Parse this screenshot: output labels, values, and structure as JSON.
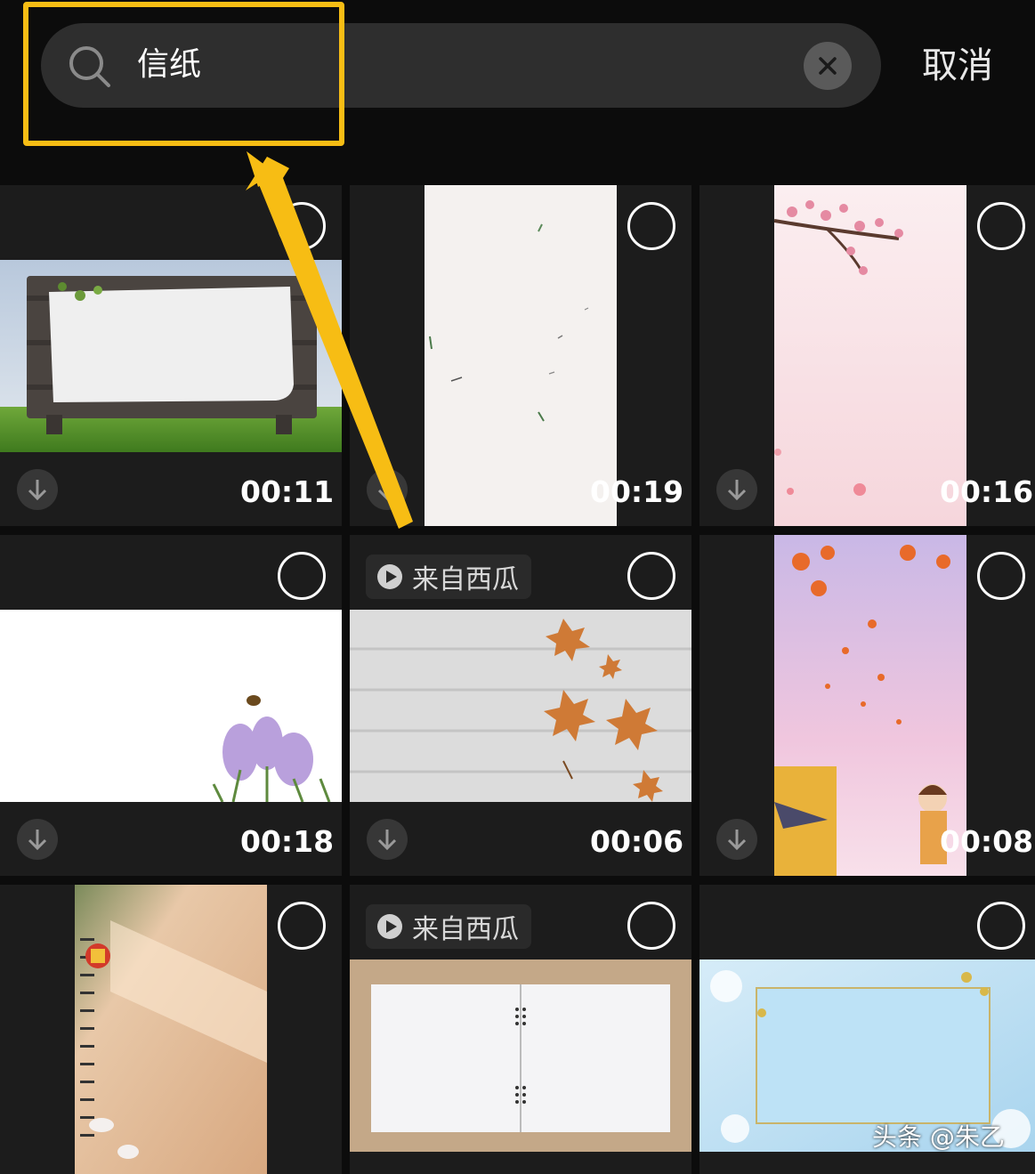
{
  "search": {
    "query": "信纸",
    "cancel_label": "取消"
  },
  "results": [
    {
      "duration": "00:11",
      "source": ""
    },
    {
      "duration": "00:19",
      "source": ""
    },
    {
      "duration": "00:16",
      "source": ""
    },
    {
      "duration": "00:18",
      "source": ""
    },
    {
      "duration": "00:06",
      "source": "来自西瓜"
    },
    {
      "duration": "00:08",
      "source": ""
    },
    {
      "duration": "",
      "source": ""
    },
    {
      "duration": "",
      "source": "来自西瓜"
    },
    {
      "duration": "",
      "source": ""
    }
  ],
  "watermark": "头条 @朱乙",
  "colors": {
    "highlight": "#f7bd14",
    "background": "#0c0c0c",
    "tile": "#1c1c1c",
    "search_bar": "#2e2e2e"
  }
}
